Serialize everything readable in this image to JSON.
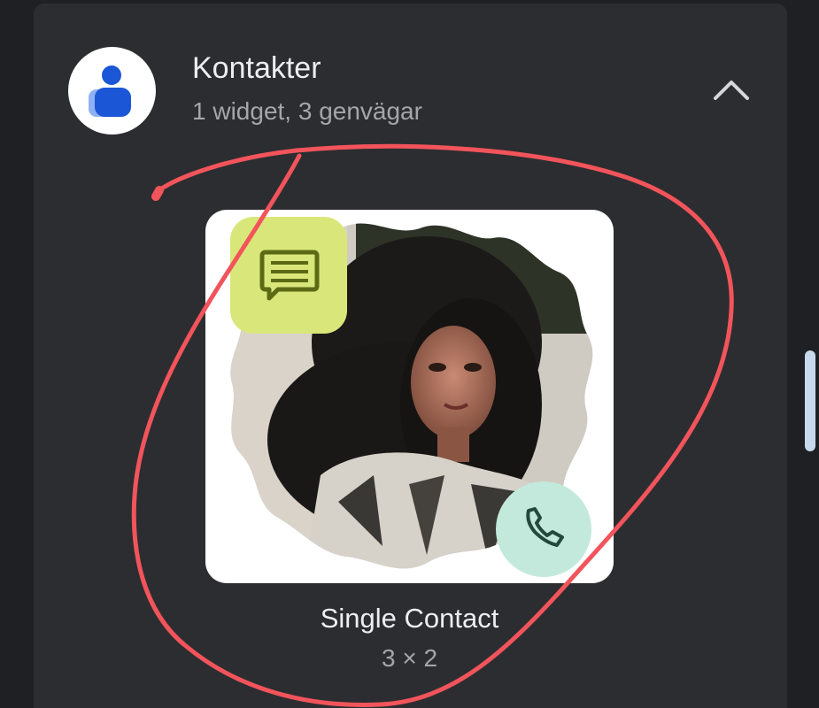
{
  "app": {
    "title": "Kontakter",
    "subtitle": "1 widget, 3 genvägar",
    "icon": "contacts-person-icon"
  },
  "widget": {
    "name": "Single Contact",
    "size": "3 × 2",
    "message_icon": "message-icon",
    "phone_icon": "phone-icon"
  },
  "colors": {
    "panel": "#2c2d30",
    "background": "#1f2023",
    "message_bubble": "#d9e77a",
    "phone_bubble": "#c3e9dc",
    "annotation_stroke": "#f2545b",
    "icon_blue": "#1a56d6",
    "icon_light_blue": "#8fb1f3"
  }
}
